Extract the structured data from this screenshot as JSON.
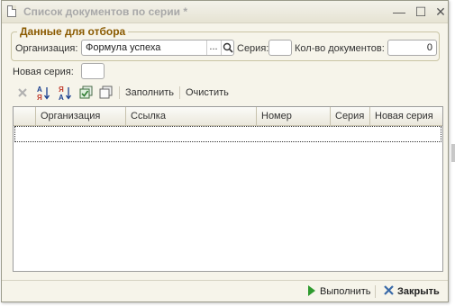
{
  "window": {
    "title": "Список документов по серии *",
    "minimize": "—",
    "maximize": "☐",
    "close": "✕"
  },
  "filter": {
    "legend": "Данные для отбора",
    "org_label": "Организация:",
    "org_value": "Формула успеха",
    "org_select_btn": "...",
    "series_label": "Серия:",
    "series_value": "",
    "count_label": "Кол-во документов:",
    "count_value": "0"
  },
  "new_series": {
    "label": "Новая серия:",
    "value": ""
  },
  "toolbar": {
    "fill_label": "Заполнить",
    "clear_label": "Очистить"
  },
  "table": {
    "columns": [
      "Организация",
      "Ссылка",
      "Номер",
      "Серия",
      "Новая серия"
    ]
  },
  "footer": {
    "execute_label": "Выполнить",
    "close_label": "Закрыть"
  }
}
